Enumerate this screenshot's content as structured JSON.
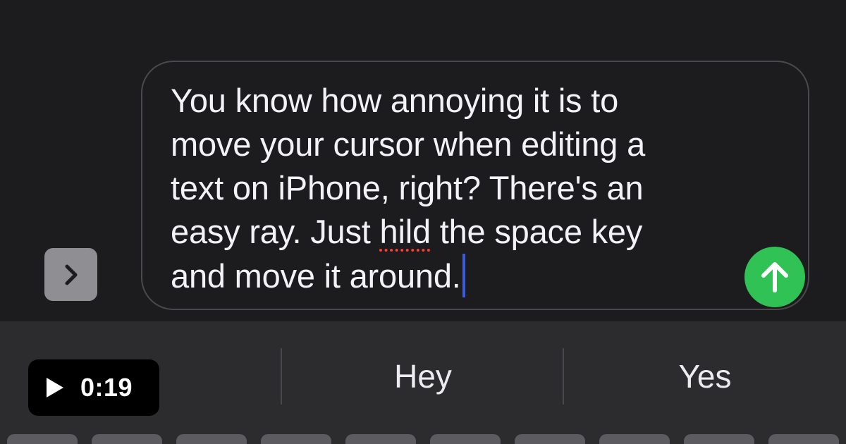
{
  "message": {
    "line_1": "You know how annoying it is to",
    "line_2": "move your cursor when editing a",
    "line_3": "text on iPhone, right? There's an",
    "line_4_before": "easy ray. Just ",
    "line_4_misspelled": "hild",
    "line_4_after": " the space key",
    "line_5": "and move it around."
  },
  "suggestions": [
    "",
    "Hey",
    "Yes"
  ],
  "video": {
    "duration": "0:19"
  },
  "icons": {
    "expand": "chevron-right-icon",
    "send": "arrow-up-icon",
    "play": "play-icon"
  },
  "colors": {
    "send_button": "#30c255",
    "cursor": "#3b5bdb",
    "spellcheck": "#ff3b30"
  }
}
